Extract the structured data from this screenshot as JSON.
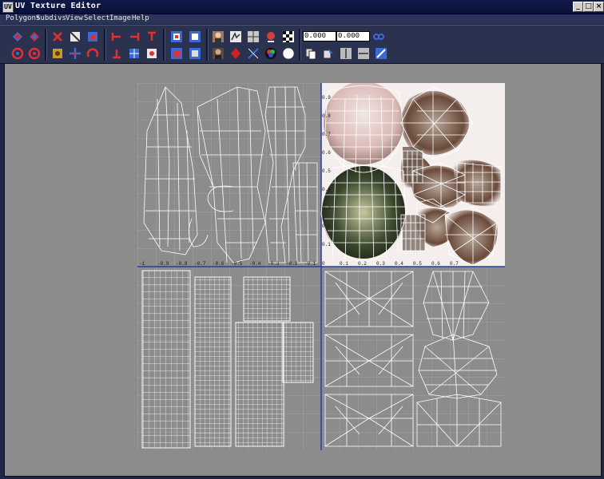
{
  "window": {
    "title": "UV Texture Editor",
    "icon": "uv-editor-icon",
    "controls": [
      "_",
      "□",
      "×"
    ]
  },
  "menubar": {
    "items": [
      "Polygons",
      "Subdivs",
      "View",
      "Select",
      "Image",
      "Help"
    ]
  },
  "toolbar": {
    "u_value": "0.000",
    "v_value": "0.000"
  },
  "canvas": {
    "axis_labels_v": [
      "0.9",
      "0.8",
      "0.7",
      "0.6",
      "0.5",
      "0.4",
      "0.3",
      "0.2",
      "0.1",
      "0"
    ],
    "axis_labels_u_left": [
      "-1",
      "-0.9",
      "-0.8",
      "-0.7",
      "-0.6",
      "-0.5",
      "-0.4",
      "-0.3",
      "-0.2",
      "-0.1"
    ],
    "axis_labels_u_right": [
      "0.1",
      "0.2",
      "0.3",
      "0.4",
      "0.5",
      "0.6",
      "0.7"
    ],
    "colors": {
      "background": "#8c8c8c",
      "grid": "#a8a8a8",
      "axis": "#2a3aa8",
      "uv_wire": "#ffffff",
      "texture_base": "#efe8e4"
    }
  }
}
